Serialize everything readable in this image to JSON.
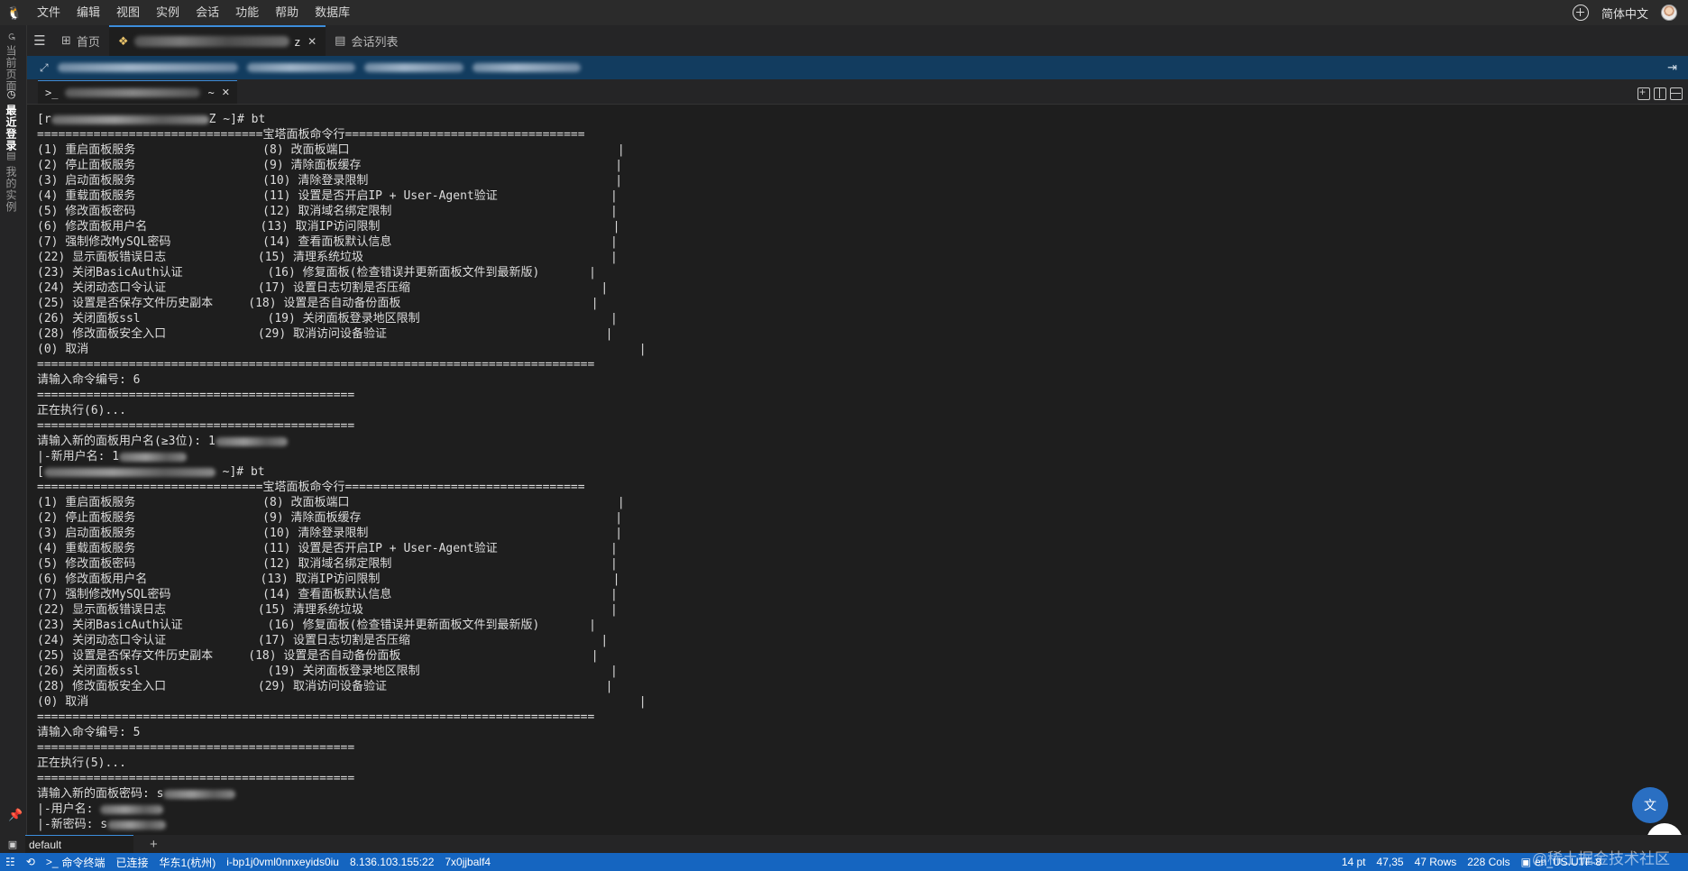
{
  "menubar": {
    "items": [
      "文件",
      "编辑",
      "视图",
      "实例",
      "会话",
      "功能",
      "帮助",
      "数据库"
    ],
    "language": "简体中文"
  },
  "activity": {
    "tabs": [
      {
        "label": "当前页面",
        "icon": "history-icon",
        "active": false
      },
      {
        "label": "最近登录",
        "icon": "clock-icon",
        "active": true
      },
      {
        "label": "我的实例",
        "icon": "server-icon",
        "active": false
      }
    ]
  },
  "tabs": {
    "home": "首页",
    "session_suffix": "z",
    "session_list": "会话列表"
  },
  "terminal_tab": {
    "prefix": ">_",
    "suffix": "~"
  },
  "terminal": {
    "lines": [
      {
        "pre": "[r",
        "blur": 175,
        "post": "Z ~]# bt"
      },
      {
        "text": "================================宝塔面板命令行=================================="
      },
      {
        "text": "(1) 重启面板服务                  (8) 改面板端口                                      |"
      },
      {
        "text": "(2) 停止面板服务                  (9) 清除面板缓存                                    |"
      },
      {
        "text": "(3) 启动面板服务                  (10) 清除登录限制                                   |"
      },
      {
        "text": "(4) 重载面板服务                  (11) 设置是否开启IP + User-Agent验证                |"
      },
      {
        "text": "(5) 修改面板密码                  (12) 取消域名绑定限制                               |"
      },
      {
        "text": "(6) 修改面板用户名                (13) 取消IP访问限制                                 |"
      },
      {
        "text": "(7) 强制修改MySQL密码             (14) 查看面板默认信息                               |"
      },
      {
        "text": "(22) 显示面板错误日志             (15) 清理系统垃圾                                   |"
      },
      {
        "text": "(23) 关闭BasicAuth认证            (16) 修复面板(检查错误并更新面板文件到最新版)       |"
      },
      {
        "text": "(24) 关闭动态口令认证             (17) 设置日志切割是否压缩                           |"
      },
      {
        "text": "(25) 设置是否保存文件历史副本     (18) 设置是否自动备份面板                           |"
      },
      {
        "text": "(26) 关闭面板ssl                  (19) 关闭面板登录地区限制                           |"
      },
      {
        "text": "(28) 修改面板安全入口             (29) 取消访问设备验证                               |"
      },
      {
        "text": "(0) 取消                                                                              |"
      },
      {
        "text": "==============================================================================="
      },
      {
        "text": "请输入命令编号: 6"
      },
      {
        "text": "============================================="
      },
      {
        "text": "正在执行(6)..."
      },
      {
        "text": "============================================="
      },
      {
        "pre": "请输入新的面板用户名(≥3位): 1",
        "blur": 80,
        "post": ""
      },
      {
        "pre": "|-新用户名: 1",
        "blur": 75,
        "post": ""
      },
      {
        "pre": "[",
        "blur": 190,
        "post": " ~]# bt"
      },
      {
        "text": "================================宝塔面板命令行=================================="
      },
      {
        "text": "(1) 重启面板服务                  (8) 改面板端口                                      |"
      },
      {
        "text": "(2) 停止面板服务                  (9) 清除面板缓存                                    |"
      },
      {
        "text": "(3) 启动面板服务                  (10) 清除登录限制                                   |"
      },
      {
        "text": "(4) 重载面板服务                  (11) 设置是否开启IP + User-Agent验证                |"
      },
      {
        "text": "(5) 修改面板密码                  (12) 取消域名绑定限制                               |"
      },
      {
        "text": "(6) 修改面板用户名                (13) 取消IP访问限制                                 |"
      },
      {
        "text": "(7) 强制修改MySQL密码             (14) 查看面板默认信息                               |"
      },
      {
        "text": "(22) 显示面板错误日志             (15) 清理系统垃圾                                   |"
      },
      {
        "text": "(23) 关闭BasicAuth认证            (16) 修复面板(检查错误并更新面板文件到最新版)       |"
      },
      {
        "text": "(24) 关闭动态口令认证             (17) 设置日志切割是否压缩                           |"
      },
      {
        "text": "(25) 设置是否保存文件历史副本     (18) 设置是否自动备份面板                           |"
      },
      {
        "text": "(26) 关闭面板ssl                  (19) 关闭面板登录地区限制                           |"
      },
      {
        "text": "(28) 修改面板安全入口             (29) 取消访问设备验证                               |"
      },
      {
        "text": "(0) 取消                                                                              |"
      },
      {
        "text": "==============================================================================="
      },
      {
        "text": "请输入命令编号: 5"
      },
      {
        "text": "============================================="
      },
      {
        "text": "正在执行(5)..."
      },
      {
        "text": "============================================="
      },
      {
        "pre": "请输入新的面板密码: s",
        "blur": 80,
        "post": ""
      },
      {
        "pre": "|-用户名: ",
        "blur": 70,
        "post": ""
      },
      {
        "pre": "|-新密码: s",
        "blur": 65,
        "post": ""
      }
    ]
  },
  "panel": {
    "tab_label": "default"
  },
  "statusbar": {
    "terminal": "命令终端",
    "connection": "已连接",
    "region": "华东1(杭州)",
    "instance_id": "i-bp1j0vml0nnxeyids0iu",
    "ip": "8.136.103.155:22",
    "session": "7x0jjbalf4",
    "font_size": "14 pt",
    "cursor": "47,35",
    "rows": "47 Rows",
    "cols": "228 Cols",
    "encoding": "en_US.UTF-8",
    "watermark": "@稀土掘金技术社区"
  },
  "colors": {
    "accent": "#1565c0",
    "infobar": "#123c5f",
    "terminal_bg": "#1e1e1e"
  }
}
